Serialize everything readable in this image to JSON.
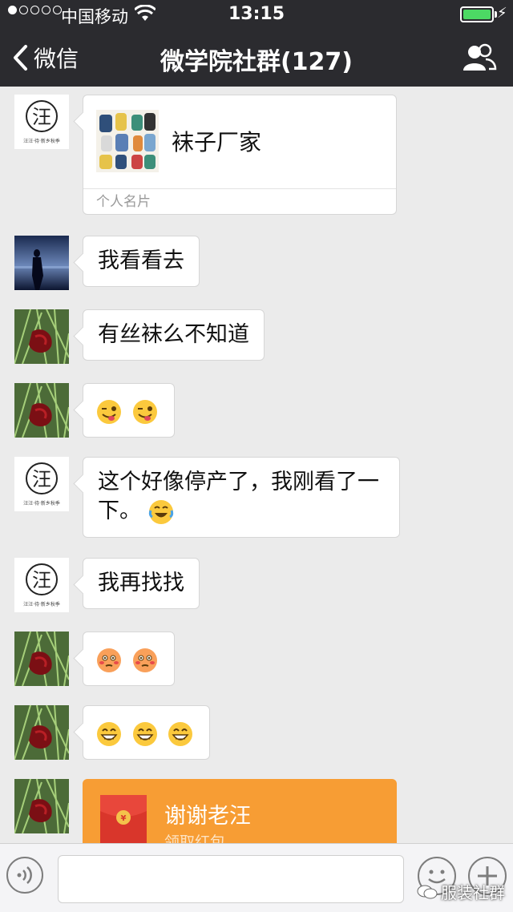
{
  "status_bar": {
    "carrier": "中国移动",
    "time": "13:15",
    "battery_level": 1.0,
    "signal_dots_filled": 1,
    "signal_dots_total": 5,
    "battery_color": "#4cd964"
  },
  "nav": {
    "back_label": "微信",
    "title": "微学院社群(127)",
    "right_icon": "group-members-icon"
  },
  "messages": [
    {
      "type": "card",
      "avatar": "wang-logo",
      "card_name": "袜子厂家",
      "card_type": "个人名片"
    },
    {
      "type": "text",
      "avatar": "night-sea-photo",
      "text": "我看看去"
    },
    {
      "type": "text",
      "avatar": "red-flower-photo",
      "text": "有丝袜么不知道"
    },
    {
      "type": "emoji",
      "avatar": "red-flower-photo",
      "emojis": [
        "wink-tongue-emoji",
        "wink-tongue-emoji"
      ]
    },
    {
      "type": "text",
      "avatar": "wang-logo",
      "text": "这个好像停产了，我刚看了一下。",
      "trailing_emoji": "crying-laughing-emoji"
    },
    {
      "type": "text",
      "avatar": "wang-logo",
      "text": "我再找找"
    },
    {
      "type": "emoji",
      "avatar": "red-flower-photo",
      "emojis": [
        "blushing-emoji",
        "blushing-emoji"
      ]
    },
    {
      "type": "emoji",
      "avatar": "red-flower-photo",
      "emojis": [
        "grinning-emoji",
        "grinning-emoji",
        "grinning-emoji"
      ]
    },
    {
      "type": "red_packet",
      "avatar": "red-flower-photo",
      "title": "谢谢老汪",
      "subtitle": "领取红包"
    }
  ],
  "avatars": {
    "wang_logo_char": "汪",
    "wang_logo_caption": "汪汪·待·新乡秋季"
  },
  "input_bar": {
    "placeholder": ""
  },
  "watermark": "服装社群",
  "colors": {
    "nav_bg": "#2b2b2f",
    "chat_bg": "#ebebeb",
    "red_packet": "#f79d34"
  }
}
